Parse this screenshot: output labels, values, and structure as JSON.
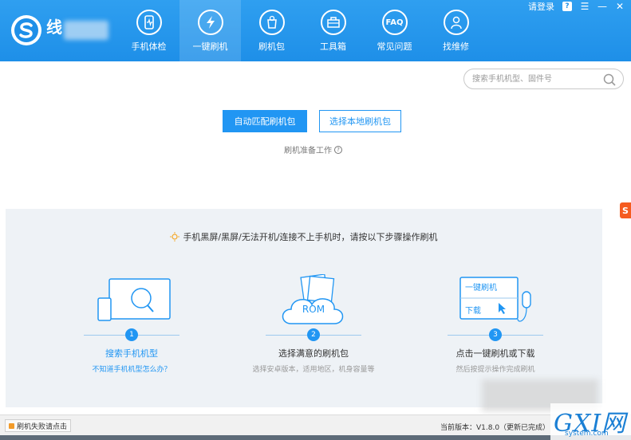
{
  "header": {
    "logo_text": "线",
    "nav": [
      {
        "label": "手机体检",
        "icon": "phone-check-icon"
      },
      {
        "label": "一键刷机",
        "icon": "lightning-icon",
        "active": true
      },
      {
        "label": "刷机包",
        "icon": "package-icon"
      },
      {
        "label": "工具箱",
        "icon": "toolbox-icon"
      },
      {
        "label": "常见问题",
        "icon": "faq-icon",
        "icon_text": "FAQ"
      },
      {
        "label": "找维修",
        "icon": "repair-person-icon"
      }
    ],
    "login": "请登录",
    "help_glyph": "?",
    "menu_glyph": "☰",
    "min_glyph": "—",
    "close_glyph": "✕"
  },
  "search": {
    "placeholder": "搜索手机机型、固件号"
  },
  "actions": {
    "auto_match": "自动匹配刷机包",
    "local_select": "选择本地刷机包",
    "prep": "刷机准备工作",
    "prep_glyph": "?"
  },
  "guide": {
    "headline": "手机黑屏/黑屏/无法开机/连接不上手机时，请按以下步骤操作刷机",
    "steps": [
      {
        "num": "1",
        "title": "搜索手机机型",
        "sub": "不知道手机机型怎么办？"
      },
      {
        "num": "2",
        "title": "选择满意的刷机包",
        "sub": "选择安卓版本，适用地区，机身容量等",
        "illus_text": "ROM"
      },
      {
        "num": "3",
        "title": "点击一键刷机或下载",
        "sub": "然后按提示操作完成刷机",
        "illus_line1": "一键刷机",
        "illus_line2": "下载"
      }
    ]
  },
  "status": {
    "fail_link": "刷机失败请点击",
    "version": "当前版本：V1.8.0（更新已完成）"
  },
  "watermark": {
    "big": "GXI网",
    "small": "system.com"
  },
  "side_mark": "S",
  "colors": {
    "brand": "#1e8fe8",
    "accent": "#2196f3",
    "panel": "#eef2f6"
  }
}
